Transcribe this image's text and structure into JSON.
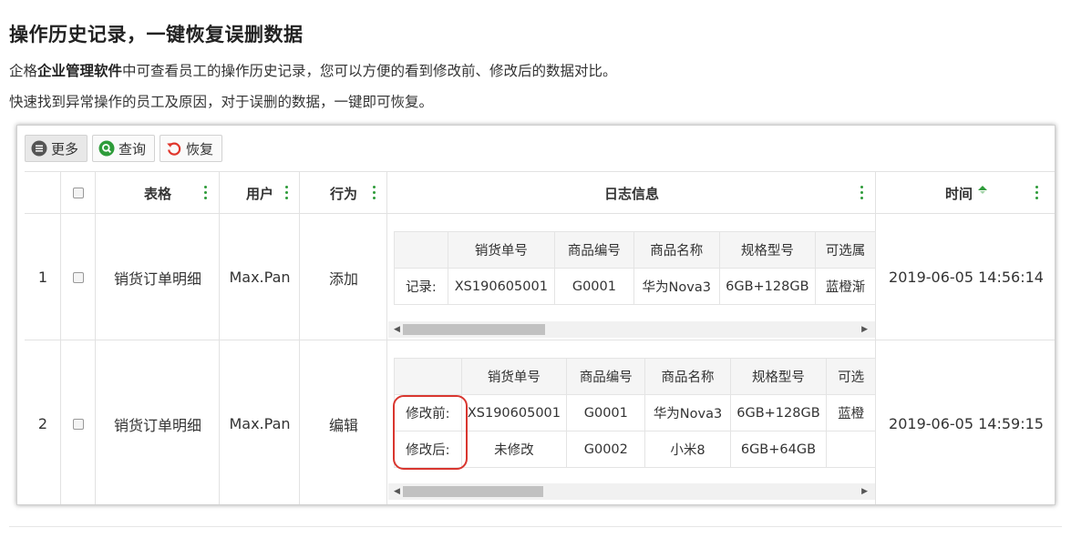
{
  "heading": "操作历史记录，一键恢复误删数据",
  "para1": {
    "pre": "企格",
    "bold": "企业管理软件",
    "post": "中可查看员工的操作历史记录，您可以方便的看到修改前、修改后的数据对比。"
  },
  "para2": "快速找到异常操作的员工及原因，对于误删的数据，一键即可恢复。",
  "toolbar": {
    "more": "更多",
    "query": "查询",
    "restore": "恢复"
  },
  "columns": {
    "table": "表格",
    "user": "用户",
    "action": "行为",
    "log": "日志信息",
    "time": "时间"
  },
  "rows": [
    {
      "index": "1",
      "table": "销货订单明细",
      "user": "Max.Pan",
      "action": "添加",
      "time": "2019-06-05 14:56:14",
      "log": {
        "headers": [
          "销货单号",
          "商品编号",
          "商品名称",
          "规格型号",
          "可选属"
        ],
        "records": [
          {
            "label": "记录:",
            "values": [
              "XS190605001",
              "G0001",
              "华为Nova3",
              "6GB+128GB",
              "蓝橙渐"
            ]
          }
        ]
      }
    },
    {
      "index": "2",
      "table": "销货订单明细",
      "user": "Max.Pan",
      "action": "编辑",
      "time": "2019-06-05 14:59:15",
      "log": {
        "headers": [
          "销货单号",
          "商品编号",
          "商品名称",
          "规格型号",
          "可选"
        ],
        "records": [
          {
            "label": "修改前:",
            "values": [
              "XS190605001",
              "G0001",
              "华为Nova3",
              "6GB+128GB",
              "蓝橙"
            ]
          },
          {
            "label": "修改后:",
            "values": [
              "未修改",
              "G0002",
              "小米8",
              "6GB+64GB",
              ""
            ]
          }
        ]
      }
    }
  ],
  "colors": {
    "accent_green": "#2e9c3a",
    "highlight_red": "#d9362f",
    "restore_red": "#e0362c"
  }
}
